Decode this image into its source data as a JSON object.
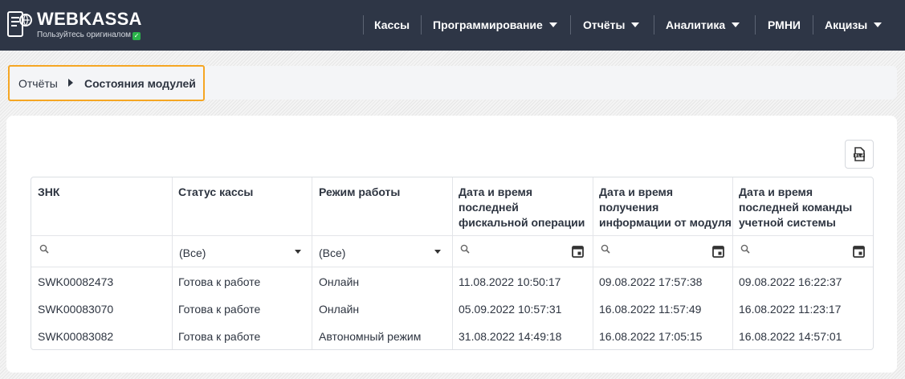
{
  "header": {
    "logo_title": "WEBKASSA",
    "logo_subtitle": "Пользуйтесь оригиналом",
    "nav": [
      {
        "label": "Кассы",
        "dropdown": false
      },
      {
        "label": "Программирование",
        "dropdown": true
      },
      {
        "label": "Отчёты",
        "dropdown": true
      },
      {
        "label": "Аналитика",
        "dropdown": true
      },
      {
        "label": "РМНИ",
        "dropdown": false
      },
      {
        "label": "Акцизы",
        "dropdown": true
      }
    ]
  },
  "breadcrumb": {
    "parent": "Отчёты",
    "current": "Состояния модулей"
  },
  "table": {
    "columns": [
      "ЗНК",
      "Статус кассы",
      "Режим работы",
      "Дата и время последней фискальной операции",
      "Дата и время получения информации от модуля",
      "Дата и время последней команды учетной системы"
    ],
    "column_lines": [
      [],
      [],
      [],
      [
        "Дата и время",
        "последней",
        "фискальной операции"
      ],
      [
        "Дата и время",
        "получения",
        "информации от модуля"
      ],
      [
        "Дата и время",
        "последней команды",
        "учетной системы"
      ]
    ],
    "filters": {
      "status": "(Все)",
      "mode": "(Все)"
    },
    "rows": [
      [
        "SWK00082473",
        "Готова к работе",
        "Онлайн",
        "11.08.2022 10:50:17",
        "09.08.2022 17:57:38",
        "09.08.2022 16:22:37"
      ],
      [
        "SWK00083070",
        "Готова к работе",
        "Онлайн",
        "05.09.2022 10:57:31",
        "16.08.2022 11:57:49",
        "16.08.2022 11:23:17"
      ],
      [
        "SWK00083082",
        "Готова к работе",
        "Автономный режим",
        "31.08.2022 14:49:18",
        "16.08.2022 17:05:15",
        "16.08.2022 14:57:01"
      ]
    ]
  },
  "colors": {
    "header_bg": "#2e3646",
    "highlight": "#f5a623",
    "check": "#2bb44a"
  },
  "icons": {
    "logo": "cash-register-icon",
    "export": "xlsx-export-icon",
    "filter_search": "search-icon",
    "date_picker": "calendar-icon"
  }
}
